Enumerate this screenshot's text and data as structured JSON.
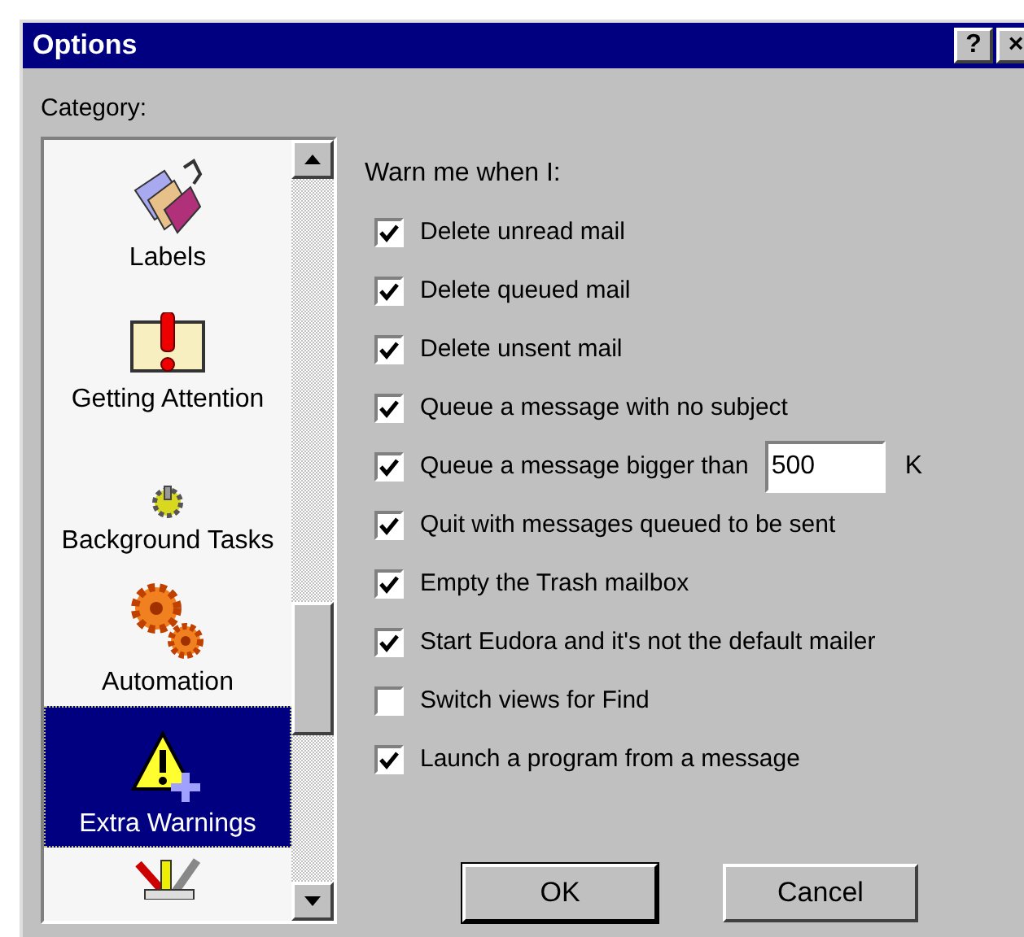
{
  "window": {
    "title": "Options",
    "title_buttons": [
      "?",
      "×"
    ]
  },
  "category_label": "Category:",
  "categories": [
    {
      "kind": "tags",
      "label": "Labels",
      "selected": false
    },
    {
      "kind": "attention",
      "label": "Getting Attention",
      "selected": false
    },
    {
      "kind": "gear",
      "label": "Background Tasks",
      "selected": false
    },
    {
      "kind": "gears",
      "label": "Automation",
      "selected": false
    },
    {
      "kind": "warning",
      "label": "Extra Warnings",
      "selected": true
    },
    {
      "kind": "tools",
      "selected": false
    }
  ],
  "group_label": "Warn me when I:",
  "options": [
    {
      "kind": "checkbox",
      "label": "Delete unread mail",
      "checked": true
    },
    {
      "kind": "checkbox",
      "label": "Delete queued mail",
      "checked": true
    },
    {
      "kind": "checkbox",
      "label": "Delete unsent mail",
      "checked": true
    },
    {
      "kind": "checkbox",
      "label": "Queue a message with no subject",
      "checked": true
    },
    {
      "kind": "number",
      "label": "Queue a message bigger than",
      "checked": true,
      "value": "500",
      "unit": "K"
    },
    {
      "kind": "checkbox",
      "label": "Quit with messages queued to be sent",
      "checked": true
    },
    {
      "kind": "checkbox",
      "label": "Empty the Trash mailbox",
      "checked": true
    },
    {
      "kind": "checkbox",
      "label": "Start Eudora and it's not the default mailer",
      "checked": true
    },
    {
      "kind": "checkbox",
      "label": "Switch views for Find",
      "checked": false
    },
    {
      "kind": "checkbox",
      "label": "Launch a program from a message",
      "checked": true
    }
  ],
  "buttons": [
    "OK",
    "Cancel"
  ]
}
